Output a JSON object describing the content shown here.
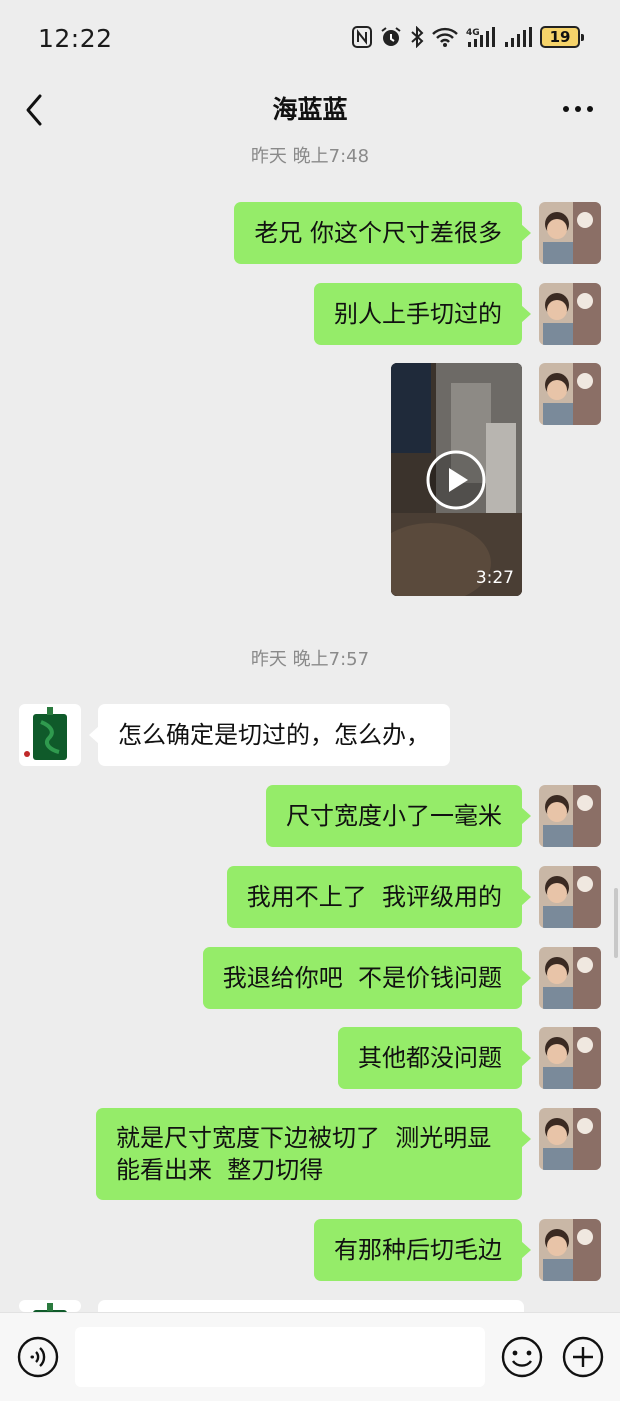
{
  "status_bar": {
    "time": "12:22",
    "battery": "19",
    "network": "4G"
  },
  "header": {
    "title": "海蓝蓝"
  },
  "timestamps": [
    "昨天 晚上7:48",
    "昨天 晚上7:57"
  ],
  "messages": [
    {
      "from": "me",
      "text": "老兄 你这个尺寸差很多"
    },
    {
      "from": "me",
      "text": "别人上手切过的"
    },
    {
      "from": "me",
      "type": "video",
      "duration": "3:27"
    },
    {
      "from": "other",
      "text": "怎么确定是切过的，怎么办，"
    },
    {
      "from": "me",
      "text": "尺寸宽度小了一毫米"
    },
    {
      "from": "me",
      "text": "我用不上了  我评级用的"
    },
    {
      "from": "me",
      "text": "我退给你吧  不是价钱问题"
    },
    {
      "from": "me",
      "text": "其他都没问题"
    },
    {
      "from": "me",
      "text": "就是尺寸宽度下边被切了  测光明显能看出来  整刀切得"
    },
    {
      "from": "me",
      "text": "有那种后切毛边"
    }
  ],
  "colors": {
    "background": "#ededed",
    "bubble_me": "#95ec69",
    "bubble_other": "#ffffff"
  }
}
